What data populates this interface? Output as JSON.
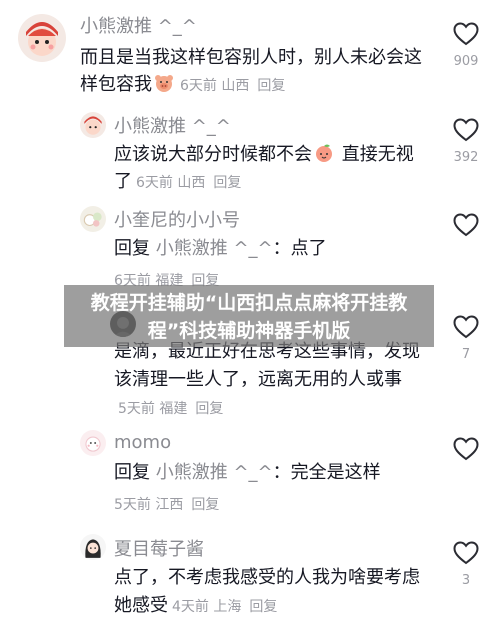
{
  "banner_text": "教程开挂辅助“山西扣点点麻将开挂教程”科技辅助神器手机版",
  "comments": [
    {
      "name": "小熊激推 ^_^",
      "text": "而且是当我这样包容别人时，别人未必会这样包容我",
      "time": "6天前",
      "location": "山西",
      "reply": "回复",
      "likes": "909",
      "emoji": "pig-emoji"
    },
    {
      "name": "小熊激推 ^_^",
      "text_before": "应该说大部分时候都不会",
      "text_after": " 直接无视了",
      "time": "6天前",
      "location": "山西",
      "reply": "回复",
      "likes": "392",
      "emoji": "peach-emoji"
    },
    {
      "name": "小奎尼的小小号",
      "text_prefix": "回复 ",
      "reply_to": "小熊激推 ^_^",
      "text_suffix": "：点了",
      "time": "6天前",
      "location": "福建",
      "reply": "回复",
      "likes": ""
    },
    {
      "name": "",
      "text": "是滴，最近正好在思考这些事情，发现该清理一些人了，远离无用的人或事",
      "time": "5天前",
      "location": "福建",
      "reply": "回复",
      "likes": "7"
    },
    {
      "name": "momo",
      "text_prefix": "回复 ",
      "reply_to": "小熊激推 ^_^",
      "text_suffix": "：完全是这样",
      "time": "5天前",
      "location": "江西",
      "reply": "回复",
      "likes": ""
    },
    {
      "name": "夏目莓子酱",
      "text": "点了，不考虑我感受的人我为啥要考虑她感受",
      "time": "4天前",
      "location": "上海",
      "reply": "回复",
      "likes": "3"
    }
  ],
  "colors": {
    "text": "#161823",
    "secondary": "#8a8b91",
    "banner_bg": "#787878"
  },
  "icons": {
    "like": "heart-outline-icon"
  }
}
